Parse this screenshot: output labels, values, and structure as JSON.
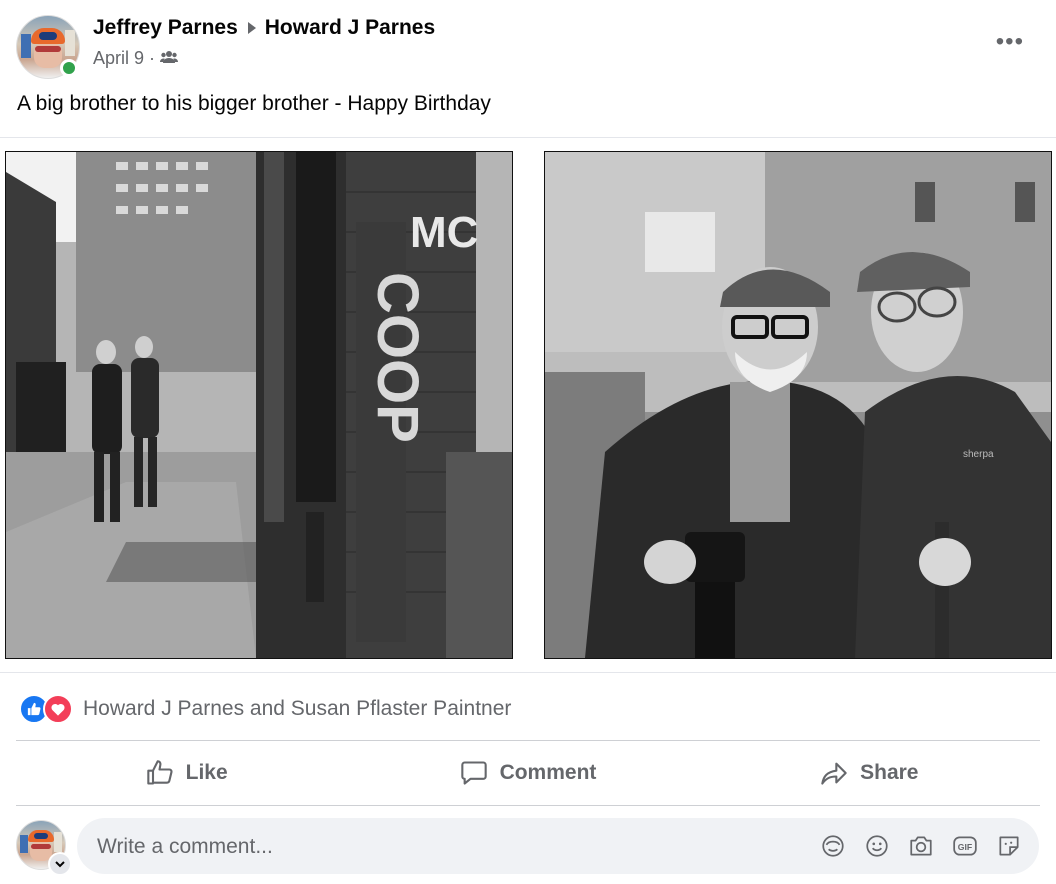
{
  "post": {
    "author": "Jeffrey Parnes",
    "recipient": "Howard J Parnes",
    "date": "April 9",
    "separator": "·",
    "text": "A big brother to his bigger brother - Happy Birthday",
    "more_options": "•••"
  },
  "photos": {
    "left": {
      "graffiti_main": "COOP",
      "graffiti_top": "MC"
    },
    "right": {
      "jacket_tag": "sherpa"
    }
  },
  "reactions": {
    "summary": "Howard J Parnes and Susan Pflaster Paintner",
    "types": [
      "like",
      "love"
    ]
  },
  "actions": {
    "like": "Like",
    "comment": "Comment",
    "share": "Share"
  },
  "comment_box": {
    "placeholder": "Write a comment...",
    "icons": [
      "avatar-sticker-icon",
      "emoji-icon",
      "camera-icon",
      "gif-icon",
      "sticker-icon"
    ]
  },
  "colors": {
    "online": "#31a24c",
    "like_blue": "#1877f2",
    "love_red": "#f33e58",
    "secondary_text": "#65676b"
  }
}
